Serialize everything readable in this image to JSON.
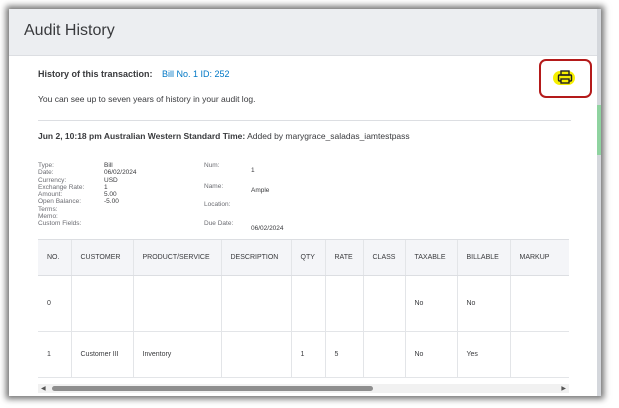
{
  "header": {
    "title": "Audit History"
  },
  "transaction": {
    "label": "History of this transaction:",
    "link": "Bill No. 1 ID: 252",
    "note": "You can see up to seven years of history in your audit log."
  },
  "print": {
    "icon": "printer-icon",
    "highlight_color": "#f6ef00",
    "outline_color": "#b41a1a"
  },
  "entry": {
    "timestamp": "Jun 2, 10:18 pm Australian Western Standard Time:",
    "added_by": "Added by marygrace_saladas_iamtestpass",
    "left_labels": [
      "Type:",
      "Date:",
      "Currency:",
      "Exchange Rate:",
      "Amount:",
      "Open Balance:",
      "Terms:",
      "Memo:",
      "Custom Fields:"
    ],
    "left_values": [
      "Bill",
      "06/02/2024",
      "USD",
      "1",
      "5.00",
      "-5.00",
      "",
      "",
      ""
    ],
    "num_label": "Num:",
    "num_value": "1",
    "name_label": "Name:",
    "name_value": "Ample",
    "location_label": "Location:",
    "location_value": "",
    "due_label": "Due Date:",
    "due_value": "06/02/2024"
  },
  "table": {
    "columns": [
      "NO.",
      "CUSTOMER",
      "PRODUCT/SERVICE",
      "DESCRIPTION",
      "QTY",
      "RATE",
      "CLASS",
      "TAXABLE",
      "BILLABLE",
      "MARKUP"
    ],
    "rows": [
      [
        "0",
        "",
        "",
        "",
        "",
        "",
        "",
        "No",
        "No",
        ""
      ],
      [
        "1",
        "Customer III",
        "Inventory",
        "",
        "1",
        "5",
        "",
        "No",
        "Yes",
        ""
      ]
    ]
  },
  "colors": {
    "accent": "#0077c5",
    "header_bg": "#eceef1"
  }
}
